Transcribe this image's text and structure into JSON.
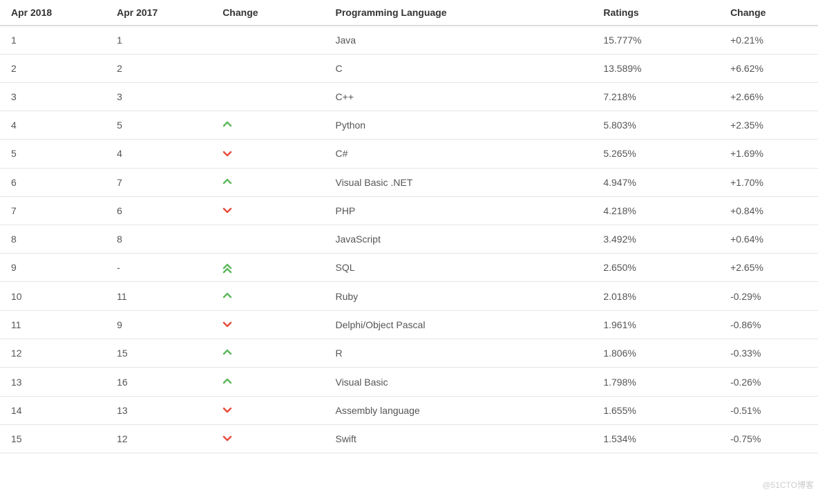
{
  "headers": {
    "apr2018": "Apr 2018",
    "apr2017": "Apr 2017",
    "change_icon": "Change",
    "language": "Programming Language",
    "ratings": "Ratings",
    "change": "Change"
  },
  "rows": [
    {
      "apr2018": "1",
      "apr2017": "1",
      "trend": "none",
      "language": "Java",
      "ratings": "15.777%",
      "change": "+0.21%"
    },
    {
      "apr2018": "2",
      "apr2017": "2",
      "trend": "none",
      "language": "C",
      "ratings": "13.589%",
      "change": "+6.62%"
    },
    {
      "apr2018": "3",
      "apr2017": "3",
      "trend": "none",
      "language": "C++",
      "ratings": "7.218%",
      "change": "+2.66%"
    },
    {
      "apr2018": "4",
      "apr2017": "5",
      "trend": "up",
      "language": "Python",
      "ratings": "5.803%",
      "change": "+2.35%"
    },
    {
      "apr2018": "5",
      "apr2017": "4",
      "trend": "down",
      "language": "C#",
      "ratings": "5.265%",
      "change": "+1.69%"
    },
    {
      "apr2018": "6",
      "apr2017": "7",
      "trend": "up",
      "language": "Visual Basic .NET",
      "ratings": "4.947%",
      "change": "+1.70%"
    },
    {
      "apr2018": "7",
      "apr2017": "6",
      "trend": "down",
      "language": "PHP",
      "ratings": "4.218%",
      "change": "+0.84%"
    },
    {
      "apr2018": "8",
      "apr2017": "8",
      "trend": "none",
      "language": "JavaScript",
      "ratings": "3.492%",
      "change": "+0.64%"
    },
    {
      "apr2018": "9",
      "apr2017": "-",
      "trend": "upup",
      "language": "SQL",
      "ratings": "2.650%",
      "change": "+2.65%"
    },
    {
      "apr2018": "10",
      "apr2017": "11",
      "trend": "up",
      "language": "Ruby",
      "ratings": "2.018%",
      "change": "-0.29%"
    },
    {
      "apr2018": "11",
      "apr2017": "9",
      "trend": "down",
      "language": "Delphi/Object Pascal",
      "ratings": "1.961%",
      "change": "-0.86%"
    },
    {
      "apr2018": "12",
      "apr2017": "15",
      "trend": "up",
      "language": "R",
      "ratings": "1.806%",
      "change": "-0.33%"
    },
    {
      "apr2018": "13",
      "apr2017": "16",
      "trend": "up",
      "language": "Visual Basic",
      "ratings": "1.798%",
      "change": "-0.26%"
    },
    {
      "apr2018": "14",
      "apr2017": "13",
      "trend": "down",
      "language": "Assembly language",
      "ratings": "1.655%",
      "change": "-0.51%"
    },
    {
      "apr2018": "15",
      "apr2017": "12",
      "trend": "down",
      "language": "Swift",
      "ratings": "1.534%",
      "change": "-0.75%"
    }
  ],
  "watermark": "@51CTO博客"
}
